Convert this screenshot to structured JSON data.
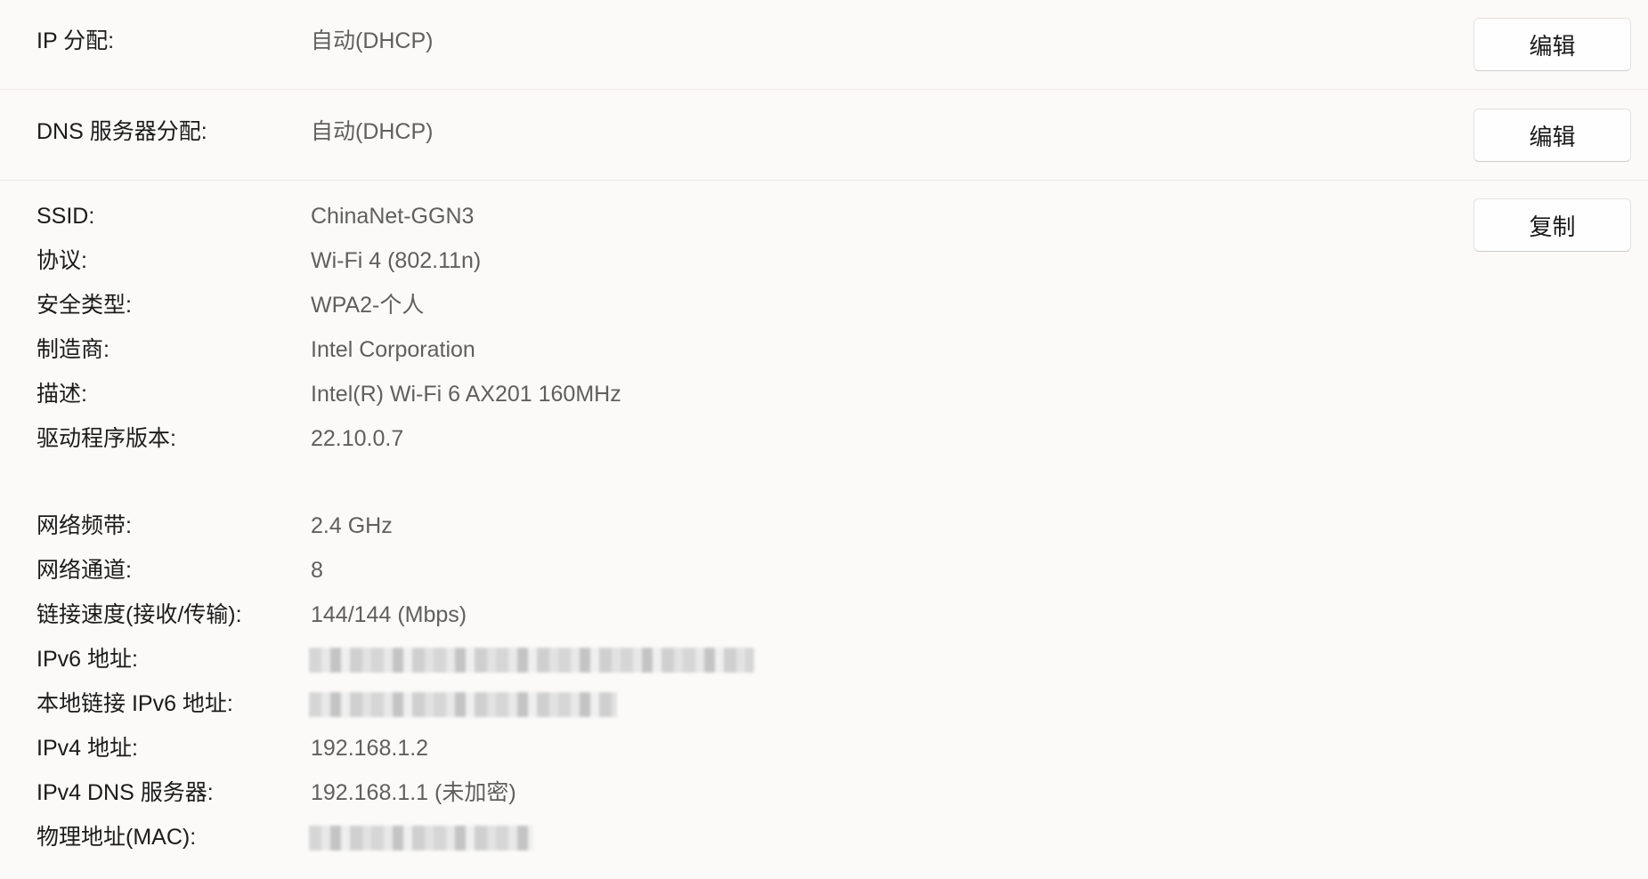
{
  "ip_assignment": {
    "label": "IP 分配:",
    "value": "自动(DHCP)",
    "button": "编辑"
  },
  "dns_assignment": {
    "label": "DNS 服务器分配:",
    "value": "自动(DHCP)",
    "button": "编辑"
  },
  "copy_button": "复制",
  "details": [
    {
      "label": "SSID:",
      "value": "ChinaNet-GGN3"
    },
    {
      "label": "协议:",
      "value": "Wi-Fi 4 (802.11n)"
    },
    {
      "label": "安全类型:",
      "value": "WPA2-个人"
    },
    {
      "label": "制造商:",
      "value": "Intel Corporation"
    },
    {
      "label": "描述:",
      "value": "Intel(R) Wi-Fi 6 AX201 160MHz"
    },
    {
      "label": "驱动程序版本:",
      "value": "22.10.0.7"
    }
  ],
  "details2": [
    {
      "label": "网络频带:",
      "value": "2.4 GHz"
    },
    {
      "label": "网络通道:",
      "value": "8"
    },
    {
      "label": "链接速度(接收/传输):",
      "value": "144/144 (Mbps)"
    },
    {
      "label": "IPv6 地址:"
    },
    {
      "label": "本地链接 IPv6 地址:"
    },
    {
      "label": "IPv4 地址:",
      "value": "192.168.1.2"
    },
    {
      "label": "IPv4 DNS 服务器:",
      "value": "192.168.1.1 (未加密)"
    },
    {
      "label": "物理地址(MAC):"
    }
  ]
}
